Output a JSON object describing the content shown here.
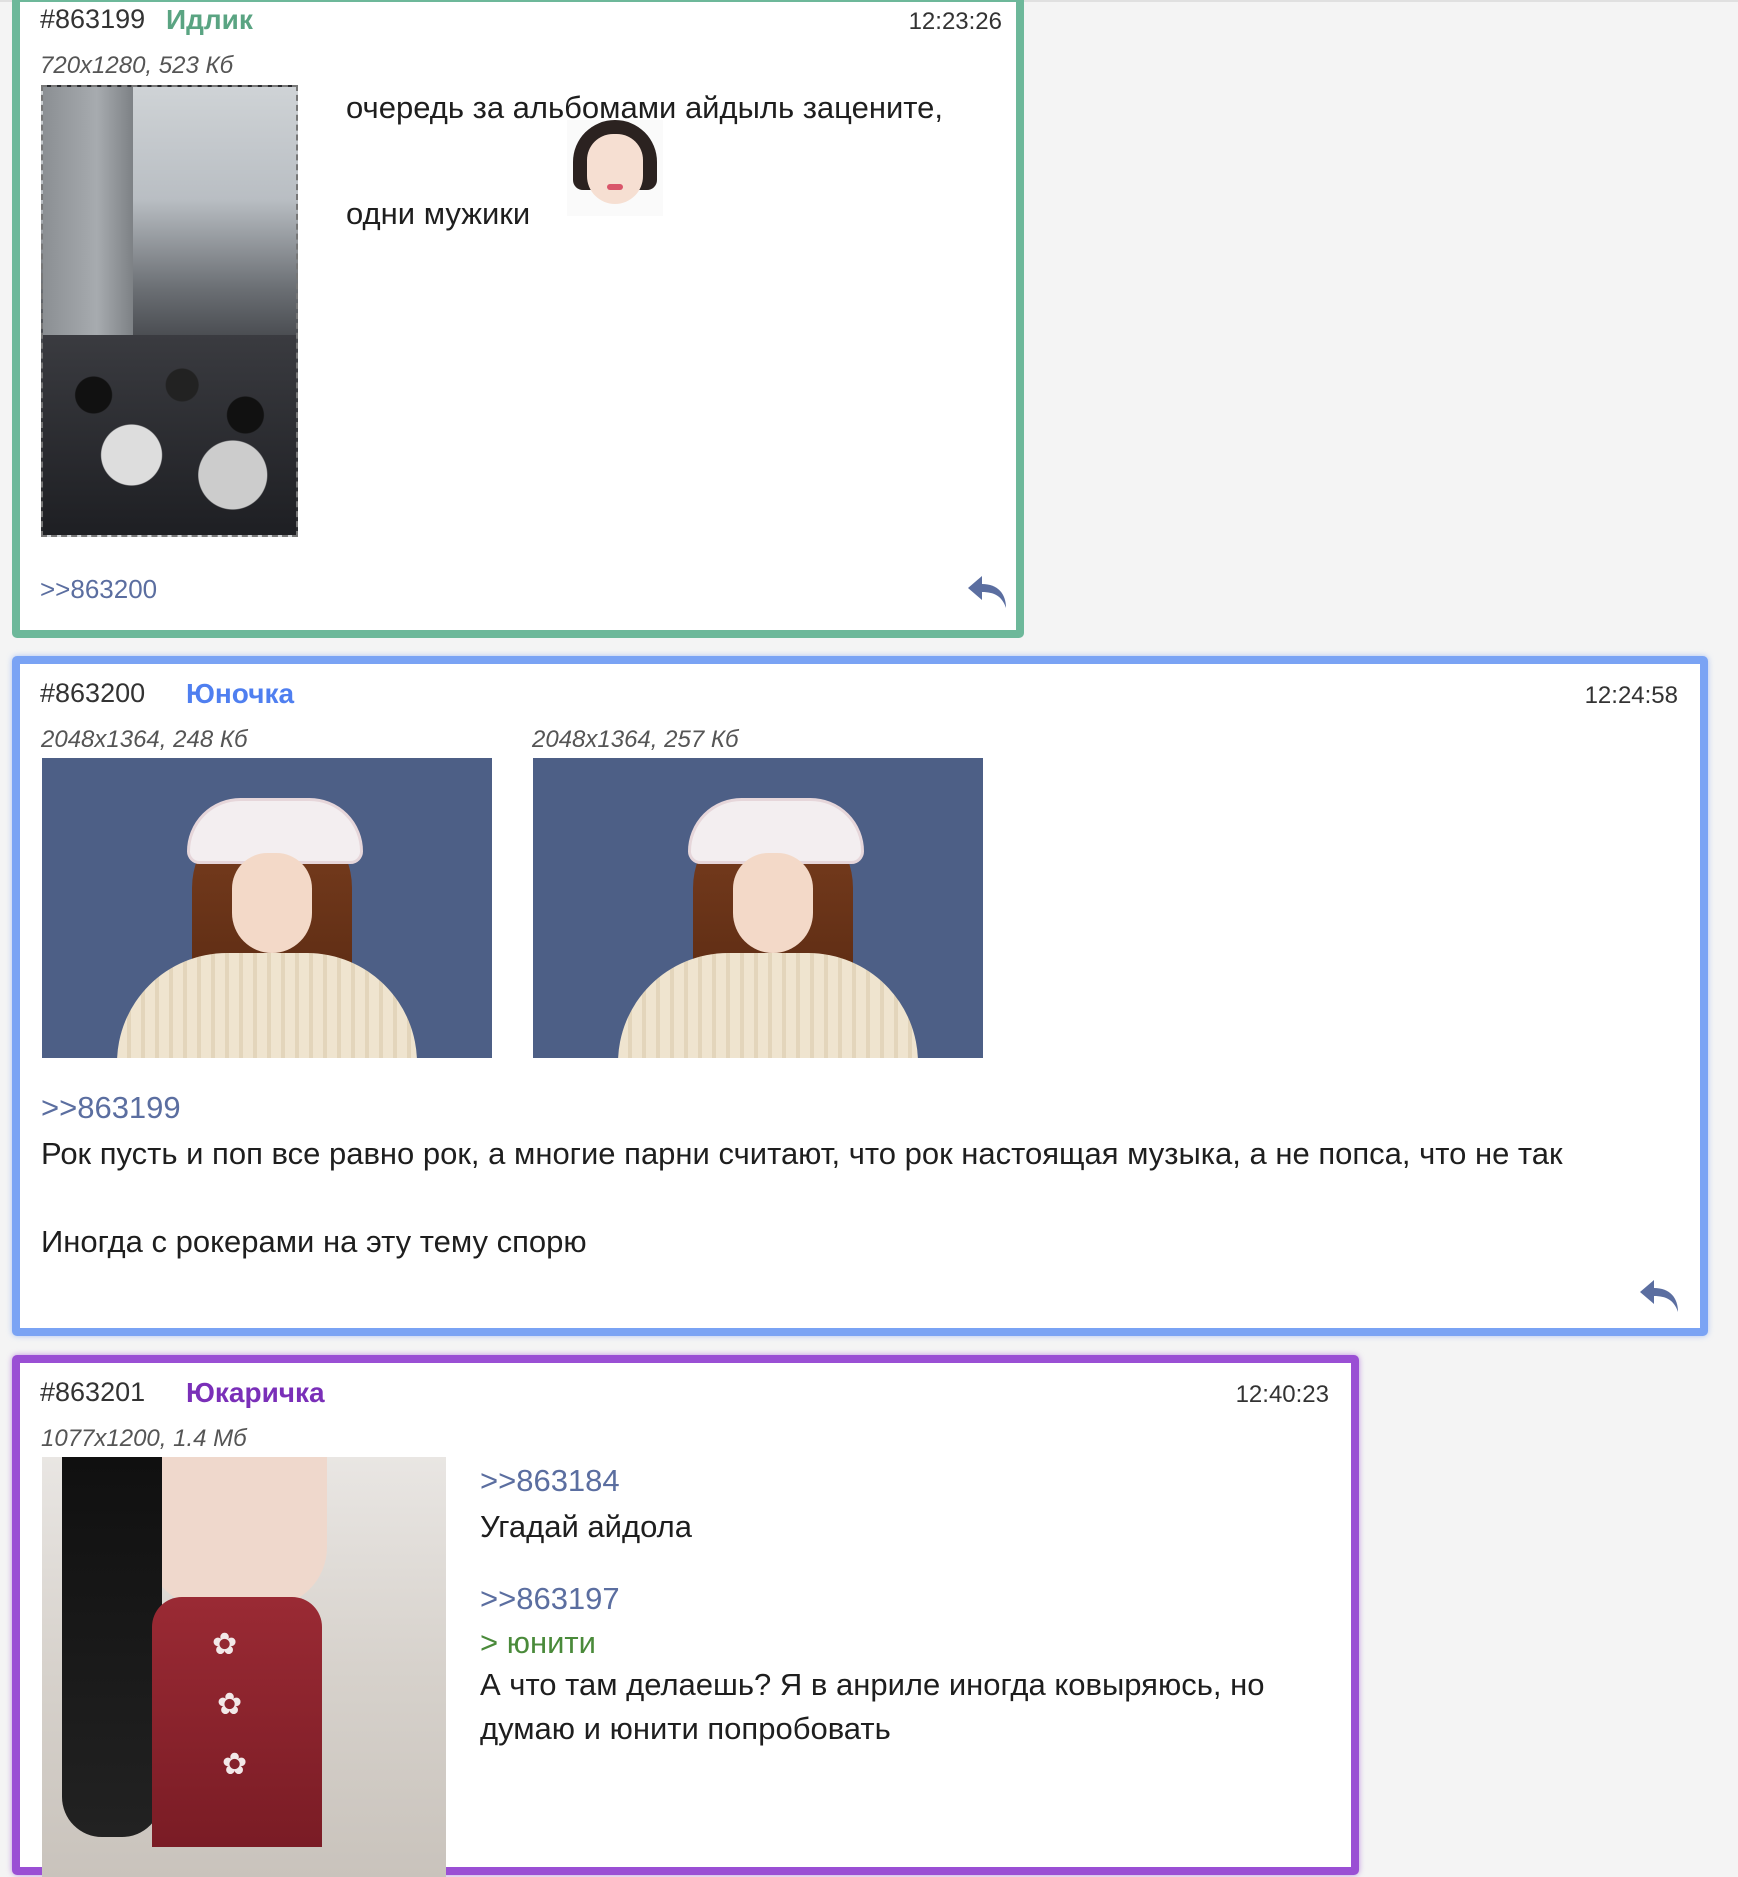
{
  "posts": [
    {
      "number": "#863199",
      "poster": "Идлик",
      "time": "12:23:26",
      "files": [
        {
          "info": "720x1280, 523 Кб"
        }
      ],
      "body_lines": [
        "очередь за альбомами айдыль заценит­е,",
        "одни мужики"
      ],
      "replies": [
        ">>863200"
      ],
      "accent": "#6db89a",
      "name_color": "#5aa482"
    },
    {
      "number": "#863200",
      "poster": "Юночка",
      "time": "12:24:58",
      "files": [
        {
          "info": "2048x1364, 248 Кб"
        },
        {
          "info": "2048x1364, 257 Кб"
        }
      ],
      "quote_ref": ">>863199",
      "body_lines": [
        "Рок пусть и поп все равно рок, а многие парни считают, что рок настоящая музыка, а не попса, что не так",
        "Иногда с рокерами на эту тему спорю"
      ],
      "accent": "#7aa3f4",
      "name_color": "#4f7ff0"
    },
    {
      "number": "#863201",
      "poster": "Юкаричка",
      "time": "12:40:23",
      "files": [
        {
          "info": "1077x1200, 1.4 Мб"
        }
      ],
      "quote_ref_1": ">>863184",
      "line_1": "Угадай айдола",
      "quote_ref_2": ">>863197",
      "greentext": "> юнити",
      "body_lines": [
        "А что там делаешь? Я в анриле иногда ковыряюсь, но",
        "думаю и юнити попробовать"
      ],
      "accent": "#9a4fd4",
      "name_color": "#7a2fb8"
    }
  ]
}
